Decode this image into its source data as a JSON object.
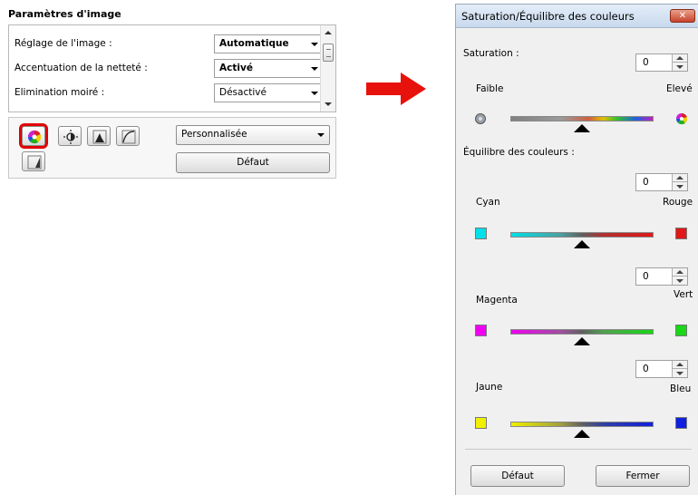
{
  "left_panel": {
    "title": "Paramètres d'image",
    "rows": [
      {
        "label": "Réglage de l'image :",
        "value": "Automatique"
      },
      {
        "label": "Accentuation de la netteté :",
        "value": "Activé"
      },
      {
        "label": "Elimination moiré :",
        "value": "Désactivé"
      }
    ],
    "tools": [
      {
        "icon": "saturation-color-balance-icon",
        "selected": true
      },
      {
        "icon": "brightness-contrast-icon",
        "selected": false
      },
      {
        "icon": "histogram-icon",
        "selected": false
      },
      {
        "icon": "tone-curve-icon",
        "selected": false
      },
      {
        "icon": "threshold-icon",
        "selected": false
      }
    ],
    "preset": "Personnalisée",
    "default_button": "Défaut"
  },
  "dialog": {
    "title": "Saturation/Équilibre des couleurs",
    "saturation": {
      "label": "Saturation :",
      "value": "0",
      "low": "Faible",
      "high": "Elevé"
    },
    "color_balance_label": "Équilibre des couleurs :",
    "balances": [
      {
        "left": "Cyan",
        "right": "Rouge",
        "value": "0",
        "left_color": "#00e0e8",
        "right_color": "#e01818"
      },
      {
        "left": "Magenta",
        "right": "Vert",
        "value": "0",
        "left_color": "#f000f0",
        "right_color": "#18d818"
      },
      {
        "left": "Jaune",
        "right": "Bleu",
        "value": "0",
        "left_color": "#f0f000",
        "right_color": "#1020e0"
      }
    ],
    "buttons": {
      "default": "Défaut",
      "close": "Fermer"
    }
  },
  "colors": {
    "highlight": "#e00000",
    "arrow": "#e8120c"
  }
}
